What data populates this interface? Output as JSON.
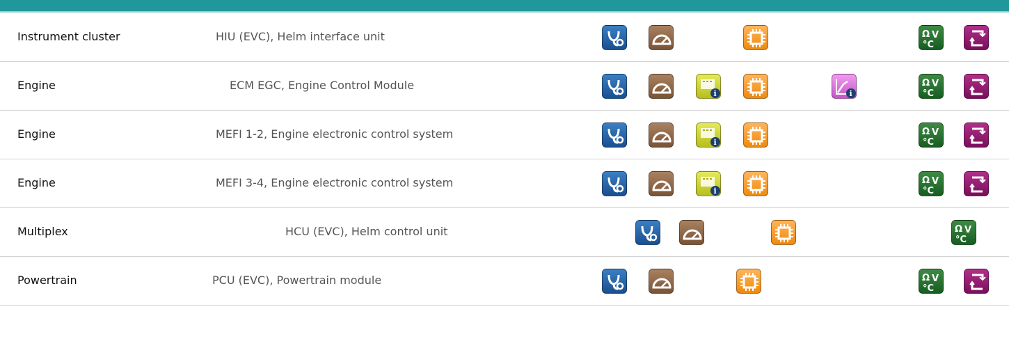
{
  "rows": [
    {
      "system": "Instrument cluster",
      "unit": "HIU (EVC), Helm interface unit",
      "icons": [
        "stethoscope-icon",
        "gauge-icon",
        "chip-icon",
        "ohm-volt-celsius-icon",
        "swap-arrows-icon"
      ]
    },
    {
      "system": "Engine",
      "unit": "ECM EGC, Engine Control Module",
      "icons": [
        "stethoscope-icon",
        "gauge-icon",
        "module-info-icon",
        "chip-icon",
        "graph-info-icon",
        "ohm-volt-celsius-icon",
        "swap-arrows-icon"
      ]
    },
    {
      "system": "Engine",
      "unit": "MEFI 1-2, Engine electronic control system",
      "icons": [
        "stethoscope-icon",
        "gauge-icon",
        "module-info-icon",
        "chip-icon",
        "ohm-volt-celsius-icon",
        "swap-arrows-icon"
      ]
    },
    {
      "system": "Engine",
      "unit": "MEFI 3-4, Engine electronic control system",
      "icons": [
        "stethoscope-icon",
        "gauge-icon",
        "module-info-icon",
        "chip-icon",
        "ohm-volt-celsius-icon",
        "swap-arrows-icon"
      ]
    },
    {
      "system": "Multiplex",
      "unit": "HCU (EVC), Helm control unit",
      "icons": [
        "stethoscope-icon",
        "gauge-icon",
        "chip-icon",
        "ohm-volt-celsius-icon"
      ]
    },
    {
      "system": "Powertrain",
      "unit": "PCU (EVC), Powertrain module",
      "icons": [
        "stethoscope-icon",
        "gauge-icon",
        "chip-icon",
        "ohm-volt-celsius-icon",
        "swap-arrows-icon"
      ]
    }
  ],
  "colors": {
    "header": "#20979a",
    "stethoscope": "#1b4f8f",
    "gauge": "#7a5437",
    "module_info": "#c2c822",
    "chip": "#f39316",
    "graph_info": "#c554c5",
    "ohm_volt_celsius": "#175d22",
    "swap_arrows": "#7a0f5c"
  }
}
